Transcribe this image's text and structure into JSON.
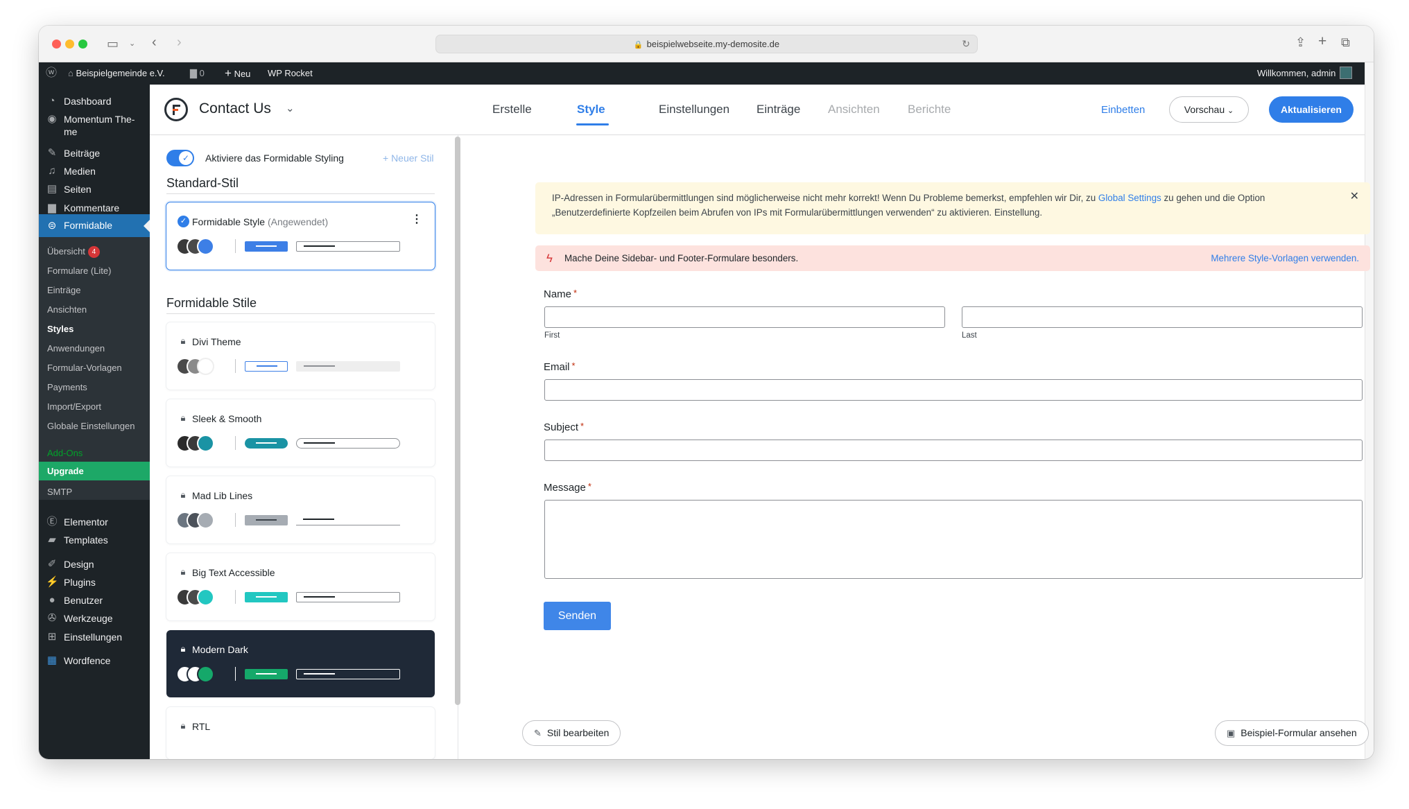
{
  "browser": {
    "url": "beispielwebseite.my-demosite.de"
  },
  "adminbar": {
    "site_name": "Beispielgemeinde e.V.",
    "comments_count": "0",
    "new_label": "Neu",
    "wp_rocket": "WP Rocket",
    "greeting": "Willkommen, admin"
  },
  "sidebar": {
    "items": [
      {
        "label": "Dashboard",
        "icon": "dashboard-icon"
      },
      {
        "label": "Momentum Theme",
        "icon": "momentum-icon"
      },
      {
        "label": "Beiträge",
        "icon": "pin-icon"
      },
      {
        "label": "Medien",
        "icon": "media-icon"
      },
      {
        "label": "Seiten",
        "icon": "page-icon"
      },
      {
        "label": "Kommentare",
        "icon": "comment-icon"
      },
      {
        "label": "Formidable",
        "icon": "formidable-icon"
      },
      {
        "label": "Elementor",
        "icon": "elementor-icon"
      },
      {
        "label": "Templates",
        "icon": "folder-icon"
      },
      {
        "label": "Design",
        "icon": "brush-icon"
      },
      {
        "label": "Plugins",
        "icon": "plug-icon"
      },
      {
        "label": "Benutzer",
        "icon": "user-icon"
      },
      {
        "label": "Werkzeuge",
        "icon": "wrench-icon"
      },
      {
        "label": "Einstellungen",
        "icon": "settings-icon"
      },
      {
        "label": "Wordfence",
        "icon": "wordfence-icon"
      }
    ],
    "momentum_line1": "Momentum The-",
    "momentum_line2": "me",
    "submenu": [
      {
        "label": "Übersicht",
        "badge": "4"
      },
      {
        "label": "Formulare (Lite)"
      },
      {
        "label": "Einträge"
      },
      {
        "label": "Ansichten"
      },
      {
        "label": "Styles"
      },
      {
        "label": "Anwendungen"
      },
      {
        "label": "Formular-Vorlagen"
      },
      {
        "label": "Payments"
      },
      {
        "label": "Import/Export"
      },
      {
        "label": "Globale Einstellungen"
      },
      {
        "label": "Add-Ons"
      },
      {
        "label": "Upgrade"
      },
      {
        "label": "SMTP"
      }
    ]
  },
  "header": {
    "form_title": "Contact Us",
    "tabs": [
      "Erstelle",
      "Style",
      "Einstellungen",
      "Einträge",
      "Ansichten",
      "Berichte"
    ],
    "embed": "Einbetten",
    "preview": "Vorschau",
    "update": "Aktualisieren"
  },
  "styles_panel": {
    "toggle_label": "Aktiviere das Formidable Styling",
    "new_style": "+ Neuer Stil",
    "standard_heading": "Standard-Stil",
    "formidable_heading": "Formidable Stile",
    "applied_name": "Formidable Style",
    "applied_tag": "(Angewendet)",
    "styles": [
      {
        "name": "Divi Theme",
        "swatches": [
          "#4a4a4a",
          "#8a8a8a",
          "#ffffff"
        ],
        "button": "#ffffff",
        "input": "#eeeeee"
      },
      {
        "name": "Sleek & Smooth",
        "swatches": [
          "#2b2b2b",
          "#3a3a3a",
          "#1a93a4"
        ],
        "button": "#1a93a4",
        "input": "#ffffff"
      },
      {
        "name": "Mad Lib Lines",
        "swatches": [
          "#6b7580",
          "#4c525a",
          "#a6acb3"
        ],
        "button": "#a6acb3",
        "input": "#ffffff"
      },
      {
        "name": "Big Text Accessible",
        "swatches": [
          "#3a3a3a",
          "#4a4a4a",
          "#22c7c1"
        ],
        "button": "#22c7c1",
        "input": "#ffffff"
      },
      {
        "name": "Modern Dark",
        "swatches": [
          "#ffffff",
          "#ffffff",
          "#15a86a"
        ],
        "button": "#15a86a",
        "input": "#1f2937"
      },
      {
        "name": "RTL"
      }
    ]
  },
  "notices": {
    "ip_text": "IP-Adressen in Formularübermittlungen sind möglicherweise nicht mehr korrekt! Wenn Du Probleme bemerkst, empfehlen wir Dir, zu",
    "ip_link": "Global Settings",
    "ip_text2": "zu gehen und die Option",
    "ip_text3": "„Benutzerdefinierte Kopfzeilen beim Abrufen von IPs mit Formularübermittlungen verwenden“ zu aktivieren. Einstellung.",
    "promo_text": "Mache Deine Sidebar- und Footer-Formulare besonders.",
    "promo_link": "Mehrere Style-Vorlagen verwenden."
  },
  "form": {
    "name_label": "Name",
    "first": "First",
    "last": "Last",
    "email_label": "Email",
    "subject_label": "Subject",
    "message_label": "Message",
    "required_mark": "*",
    "submit": "Senden"
  },
  "footer_actions": {
    "edit_style": "Stil bearbeiten",
    "sample_form": "Beispiel-Formular ansehen"
  },
  "colors": {
    "primary": "#2f7ee8",
    "wp_admin_dark": "#1d2327",
    "wp_active": "#2271b1",
    "upgrade_green": "#1da867",
    "notice_yellow": "#fef8e1",
    "notice_red": "#fde2de"
  }
}
